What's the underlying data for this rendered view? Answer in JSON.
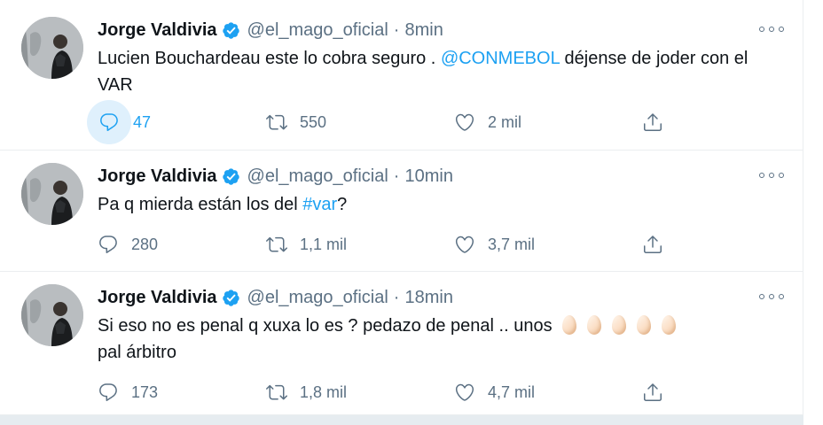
{
  "colors": {
    "accent": "#1da1f2",
    "muted": "#5b7083",
    "text": "#0f1419",
    "verified": "#1da1f2"
  },
  "icons": {
    "reply": "reply-icon",
    "retweet": "retweet-icon",
    "like": "heart-icon",
    "share": "share-icon",
    "more": "more-icon",
    "verified": "verified-badge-icon",
    "emoji": "egg-emoji"
  },
  "tweets": [
    {
      "name": "Jorge Valdivia",
      "handle": "@el_mago_oficial",
      "dot": "·",
      "time": "8min",
      "text_before": "Lucien Bouchardeau este lo cobra seguro . ",
      "link": "@CONMEBOL",
      "text_after": " déjense de joder con el VAR",
      "replies": "47",
      "retweets": "550",
      "likes": "2 mil"
    },
    {
      "name": "Jorge Valdivia",
      "handle": "@el_mago_oficial",
      "dot": "·",
      "time": "10min",
      "text_before": "Pa q mierda están los del ",
      "link": "#var",
      "text_after": "?",
      "replies": "280",
      "retweets": "1,1 mil",
      "likes": "3,7 mil"
    },
    {
      "name": "Jorge Valdivia",
      "handle": "@el_mago_oficial",
      "dot": "·",
      "time": "18min",
      "text_before": "Si eso no es penal q xuxa lo es ? pedazo de penal .. unos",
      "text_after": "pal árbitro",
      "emoji_count": 5,
      "replies": "173",
      "retweets": "1,8 mil",
      "likes": "4,7 mil"
    }
  ]
}
